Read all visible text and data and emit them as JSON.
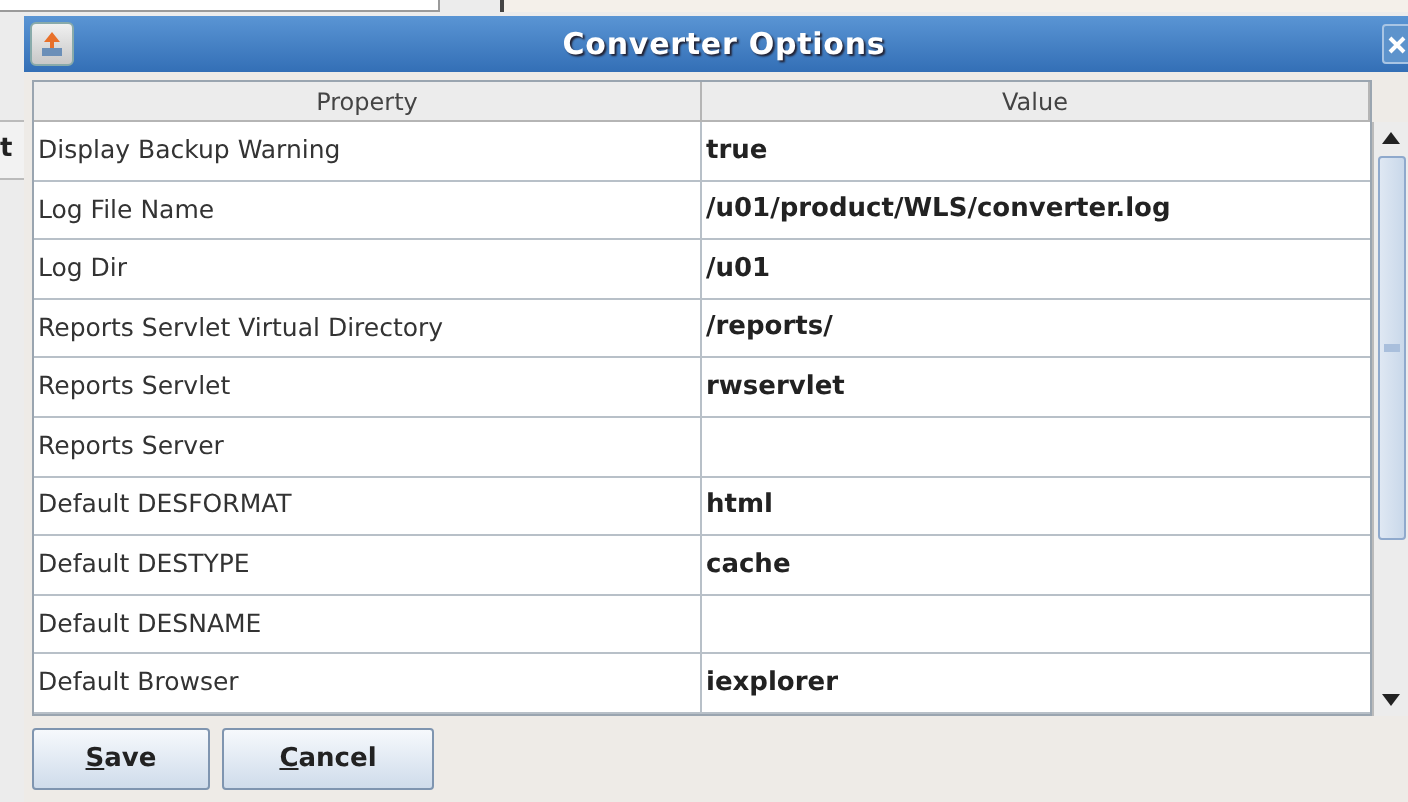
{
  "background_fragment": "t",
  "window": {
    "title": "Converter Options"
  },
  "table": {
    "columns": [
      "Property",
      "Value"
    ],
    "rows": [
      {
        "property": "Display Backup Warning",
        "value": "true"
      },
      {
        "property": "Log File Name",
        "value": "/u01/product/WLS/converter.log"
      },
      {
        "property": "Log Dir",
        "value": "/u01"
      },
      {
        "property": "Reports Servlet Virtual Directory",
        "value": "/reports/"
      },
      {
        "property": "Reports Servlet",
        "value": "rwservlet"
      },
      {
        "property": "Reports Server"
      },
      {
        "property": "Default DESFORMAT",
        "value": "html"
      },
      {
        "property": "Default DESTYPE",
        "value": "cache"
      },
      {
        "property": "Default DESNAME"
      },
      {
        "property": "Default Browser",
        "value": "iexplorer"
      }
    ]
  },
  "buttons": [
    {
      "label": "Save",
      "mnemonic_underlined": true
    },
    {
      "label": "Cancel",
      "mnemonic_underlined": true
    }
  ]
}
